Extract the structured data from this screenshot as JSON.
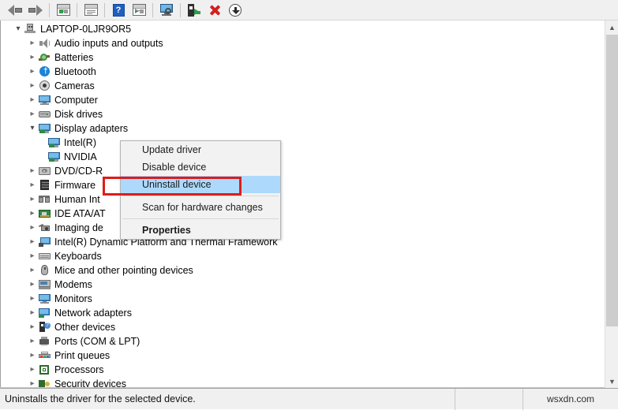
{
  "toolbar": {
    "buttons": [
      {
        "name": "back-icon",
        "label": "Back"
      },
      {
        "name": "forward-icon",
        "label": "Forward"
      },
      {
        "name": "show-hide-console-tree-icon",
        "label": "Show/Hide Console Tree"
      },
      {
        "name": "properties-icon",
        "label": "Properties"
      },
      {
        "name": "help-icon",
        "label": "Help"
      },
      {
        "name": "update-driver-icon",
        "label": "Update Driver Software"
      },
      {
        "name": "scan-for-hardware-changes-icon",
        "label": "Scan for hardware changes"
      },
      {
        "name": "enable-device-icon",
        "label": "Enable device"
      },
      {
        "name": "uninstall-device-icon",
        "label": "Uninstall device"
      },
      {
        "name": "install-legacy-hardware-icon",
        "label": "Add legacy hardware"
      }
    ]
  },
  "tree": {
    "root": {
      "label": "LAPTOP-0LJR9OR5",
      "expanded": true,
      "icon": "computer-node-icon"
    },
    "items": [
      {
        "label": "Audio inputs and outputs",
        "icon": "speaker-icon",
        "expanded": false,
        "indent": 1
      },
      {
        "label": "Batteries",
        "icon": "battery-icon",
        "expanded": false,
        "indent": 1
      },
      {
        "label": "Bluetooth",
        "icon": "bluetooth-icon",
        "expanded": false,
        "indent": 1
      },
      {
        "label": "Cameras",
        "icon": "camera-icon",
        "expanded": false,
        "indent": 1
      },
      {
        "label": "Computer",
        "icon": "monitor-icon",
        "expanded": false,
        "indent": 1
      },
      {
        "label": "Disk drives",
        "icon": "disk-drive-icon",
        "expanded": false,
        "indent": 1
      },
      {
        "label": "Display adapters",
        "icon": "display-adapter-icon",
        "expanded": true,
        "indent": 1
      },
      {
        "label": "Intel(R)",
        "icon": "display-adapter-icon",
        "expanded": null,
        "indent": 2,
        "selected": true
      },
      {
        "label": "NVIDIA",
        "icon": "display-adapter-icon",
        "expanded": null,
        "indent": 2
      },
      {
        "label": "DVD/CD-R",
        "icon": "dvd-drive-icon",
        "expanded": false,
        "indent": 1
      },
      {
        "label": "Firmware",
        "icon": "firmware-icon",
        "expanded": false,
        "indent": 1
      },
      {
        "label": "Human Int",
        "icon": "hid-icon",
        "expanded": false,
        "indent": 1
      },
      {
        "label": "IDE ATA/AT",
        "icon": "ide-controller-icon",
        "expanded": false,
        "indent": 1
      },
      {
        "label": "Imaging de",
        "icon": "imaging-device-icon",
        "expanded": false,
        "indent": 1
      },
      {
        "label": "Intel(R) Dynamic Platform and Thermal Framework",
        "icon": "intel-thermal-icon",
        "expanded": false,
        "indent": 1
      },
      {
        "label": "Keyboards",
        "icon": "keyboard-icon",
        "expanded": false,
        "indent": 1
      },
      {
        "label": "Mice and other pointing devices",
        "icon": "mouse-icon",
        "expanded": false,
        "indent": 1
      },
      {
        "label": "Modems",
        "icon": "modem-icon",
        "expanded": false,
        "indent": 1
      },
      {
        "label": "Monitors",
        "icon": "monitor-icon",
        "expanded": false,
        "indent": 1
      },
      {
        "label": "Network adapters",
        "icon": "network-adapter-icon",
        "expanded": false,
        "indent": 1
      },
      {
        "label": "Other devices",
        "icon": "other-device-icon",
        "expanded": false,
        "indent": 1
      },
      {
        "label": "Ports (COM & LPT)",
        "icon": "port-icon",
        "expanded": false,
        "indent": 1
      },
      {
        "label": "Print queues",
        "icon": "print-queue-icon",
        "expanded": false,
        "indent": 1
      },
      {
        "label": "Processors",
        "icon": "processor-icon",
        "expanded": false,
        "indent": 1
      },
      {
        "label": "Security devices",
        "icon": "security-device-icon",
        "expanded": false,
        "indent": 1
      }
    ]
  },
  "context_menu": {
    "items": [
      {
        "label": "Update driver",
        "highlighted": false,
        "bold": false
      },
      {
        "label": "Disable device",
        "highlighted": false,
        "bold": false
      },
      {
        "label": "Uninstall device",
        "highlighted": true,
        "bold": false
      },
      {
        "label": "Scan for hardware changes",
        "highlighted": false,
        "bold": false
      },
      {
        "label": "Properties",
        "highlighted": false,
        "bold": true
      }
    ]
  },
  "status_bar": {
    "message": "Uninstalls the driver for the selected device.",
    "watermark": "wsxdn.com"
  },
  "colors": {
    "selection": "#cde8ff",
    "menu_highlight": "#addafc",
    "annotation_red": "#e01b1b",
    "toolbar_bg": "#f0f0f0"
  }
}
